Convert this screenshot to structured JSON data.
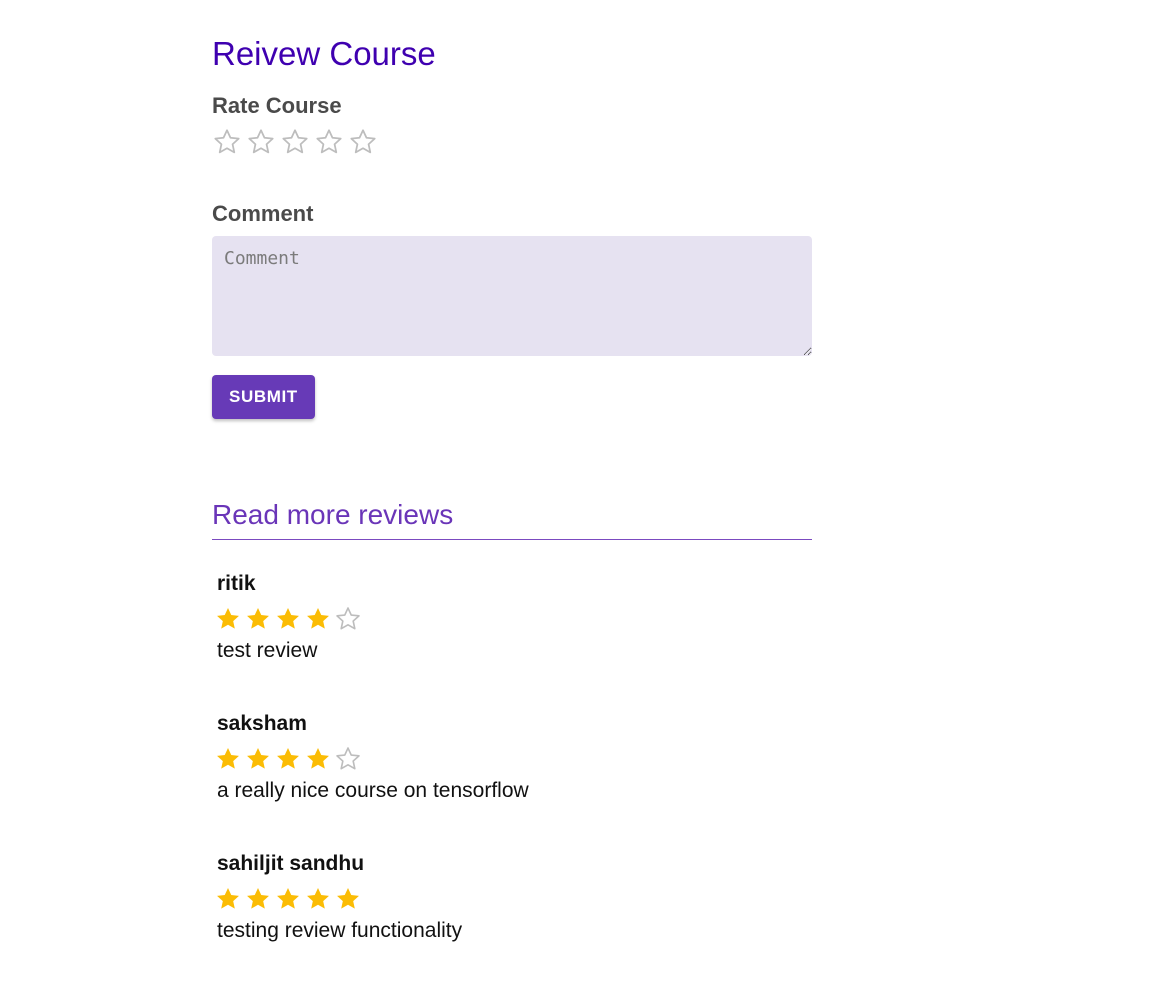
{
  "page_title": "Reivew Course",
  "rating_section": {
    "label": "Rate Course",
    "max_stars": 5,
    "selected": 0
  },
  "comment_section": {
    "label": "Comment",
    "placeholder": "Comment",
    "value": ""
  },
  "submit_label": "SUBMIT",
  "reviews_title": "Read more reviews",
  "reviews": [
    {
      "name": "ritik",
      "rating": 4,
      "text": "test review"
    },
    {
      "name": "saksham",
      "rating": 4,
      "text": "a really nice course on tensorflow"
    },
    {
      "name": "sahiljit sandhu",
      "rating": 5,
      "text": "testing review functionality"
    }
  ],
  "colors": {
    "title": "#3f00b0",
    "accent": "#673ab7",
    "star_filled": "#fbbc04",
    "star_empty": "#bdbdbd",
    "input_bg": "#e6e2f1"
  },
  "icons": {
    "filled": "star-filled-icon",
    "empty": "star-outline-icon"
  }
}
